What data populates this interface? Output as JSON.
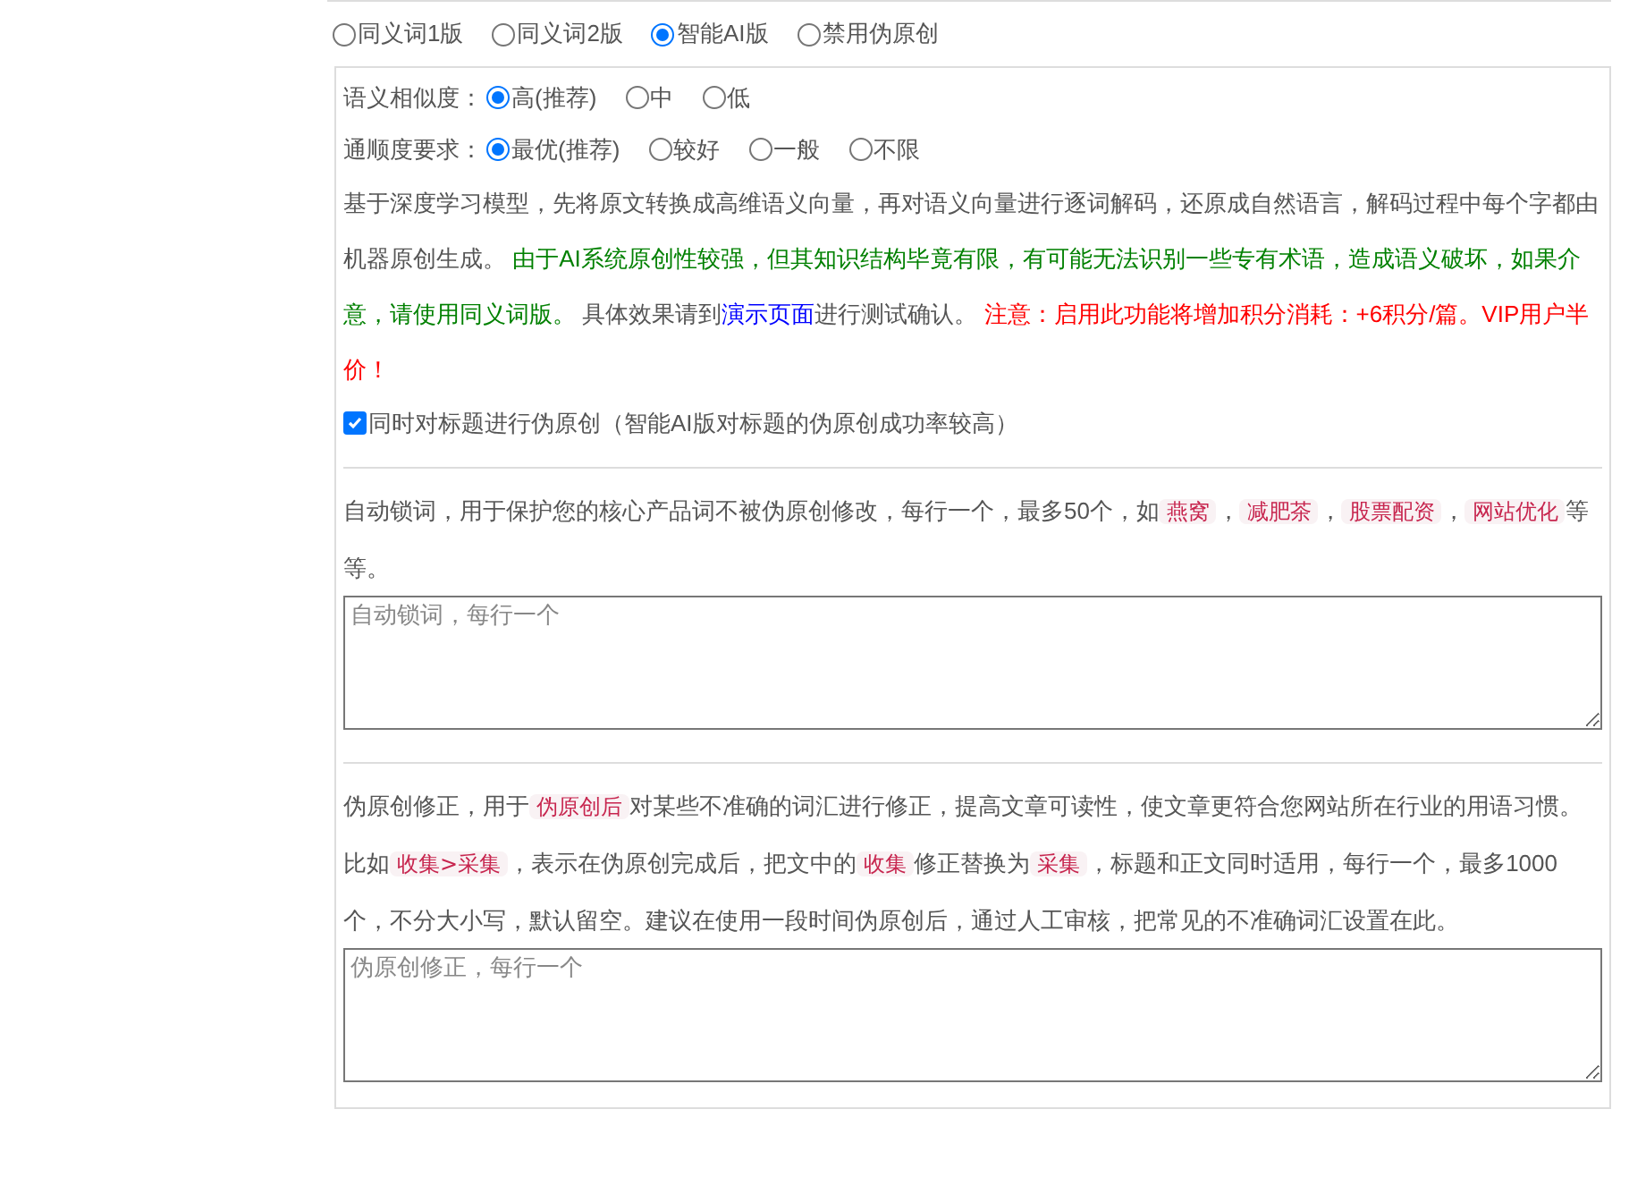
{
  "modes": [
    {
      "label": "同义词1版",
      "selected": false
    },
    {
      "label": "同义词2版",
      "selected": false
    },
    {
      "label": "智能AI版",
      "selected": true
    },
    {
      "label": "禁用伪原创",
      "selected": false
    }
  ],
  "ai_settings": {
    "options": [
      {
        "label": "语义相似度：",
        "choices": [
          {
            "label": "高(推荐)",
            "selected": true
          },
          {
            "label": "中",
            "selected": false
          },
          {
            "label": "低",
            "selected": false
          }
        ]
      },
      {
        "label": "通顺度要求：",
        "choices": [
          {
            "label": "最优(推荐)",
            "selected": true
          },
          {
            "label": "较好",
            "selected": false
          },
          {
            "label": "一般",
            "selected": false
          },
          {
            "label": "不限",
            "selected": false
          }
        ]
      }
    ],
    "description": [
      {
        "kind": "plain",
        "text": "基于深度学习模型，先将原文转换成高维语义向量，再对语义向量进行逐词解码，还原成自然语言，解码过程中每个字都由机器原创生成。 "
      },
      {
        "kind": "green",
        "text": "由于AI系统原创性较强，但其知识结构毕竟有限，有可能无法识别一些专有术语，造成语义破坏，如果介意，请使用同义词版。"
      },
      {
        "kind": "plain",
        "text": " 具体效果请到"
      },
      {
        "kind": "link",
        "text": "演示页面"
      },
      {
        "kind": "plain",
        "text": "进行测试确认。 "
      },
      {
        "kind": "red",
        "text": "注意：启用此功能将增加积分消耗：+6积分/篇。VIP用户半价！"
      }
    ],
    "title_option": {
      "label": "同时对标题进行伪原创（智能AI版对标题的伪原创成功率较高）",
      "checked": true
    }
  },
  "lock_words": {
    "description": [
      {
        "kind": "plain",
        "text": "自动锁词，用于保护您的核心产品词不被伪原创修改，每行一个，最多50个，如"
      },
      {
        "kind": "code",
        "text": "燕窝"
      },
      {
        "kind": "plain",
        "text": "，"
      },
      {
        "kind": "code",
        "text": "减肥茶"
      },
      {
        "kind": "plain",
        "text": "，"
      },
      {
        "kind": "code",
        "text": "股票配资"
      },
      {
        "kind": "plain",
        "text": "，"
      },
      {
        "kind": "code",
        "text": "网站优化"
      },
      {
        "kind": "plain",
        "text": "等等。"
      }
    ],
    "placeholder": "自动锁词，每行一个"
  },
  "corrections": {
    "description": [
      {
        "kind": "plain",
        "text": "伪原创修正，用于"
      },
      {
        "kind": "code",
        "text": "伪原创后"
      },
      {
        "kind": "plain",
        "text": "对某些不准确的词汇进行修正，提高文章可读性，使文章更符合您网站所在行业的用语习惯。比如"
      },
      {
        "kind": "code",
        "text": "收集>采集"
      },
      {
        "kind": "plain",
        "text": "，表示在伪原创完成后，把文中的"
      },
      {
        "kind": "code",
        "text": "收集"
      },
      {
        "kind": "plain",
        "text": "修正替换为"
      },
      {
        "kind": "code",
        "text": "采集"
      },
      {
        "kind": "plain",
        "text": "，标题和正文同时适用，每行一个，最多1000个，不分大小写，默认留空。建议在使用一段时间伪原创后，通过人工审核，把常见的不准确词汇设置在此。"
      }
    ],
    "placeholder": "伪原创修正，每行一个"
  }
}
